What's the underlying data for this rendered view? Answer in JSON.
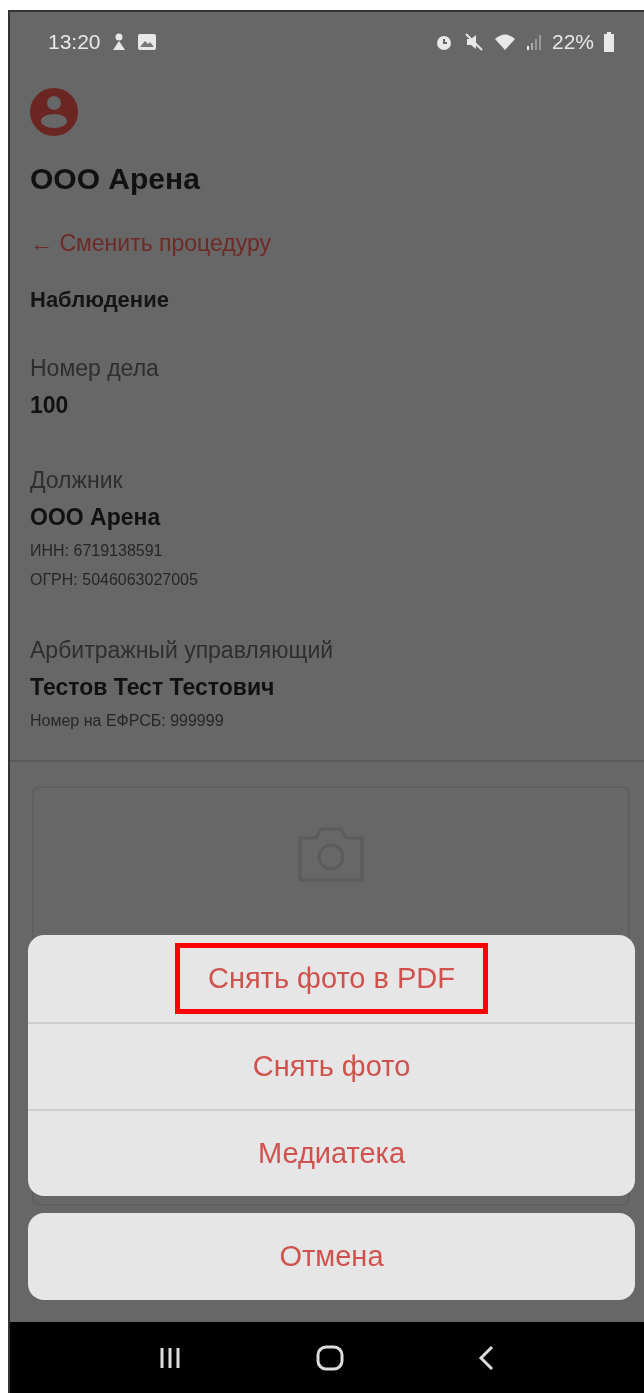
{
  "status_bar": {
    "time": "13:20",
    "battery": "22%"
  },
  "header": {
    "title": "ООО Арена",
    "back_link": "← Сменить процедуру",
    "procedure": "Наблюдение"
  },
  "fields": [
    {
      "label": "Номер дела",
      "value": "100"
    },
    {
      "label": "Должник",
      "value": "ООО Арена",
      "details": [
        "ИНН:  6719138591",
        "ОГРН: 5046063027005"
      ]
    },
    {
      "label": "Арбитражный управляющий",
      "value": "Тестов Тест Тестович",
      "details": [
        "Номер на ЕФРСБ: 999999"
      ]
    }
  ],
  "action_sheet": {
    "actions": [
      {
        "label": "Снять фото в PDF",
        "highlighted": true
      },
      {
        "label": "Снять фото",
        "highlighted": false
      },
      {
        "label": "Медиатека",
        "highlighted": false
      }
    ],
    "cancel": "Отмена"
  }
}
